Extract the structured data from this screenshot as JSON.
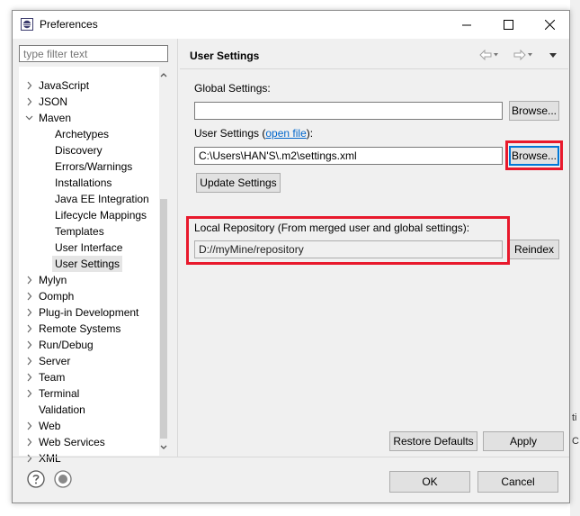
{
  "window": {
    "title": "Preferences"
  },
  "filter": {
    "placeholder": "type filter text"
  },
  "tree": {
    "items": [
      {
        "label": "JavaScript",
        "expander": "collapsed"
      },
      {
        "label": "JSON",
        "expander": "collapsed"
      },
      {
        "label": "Maven",
        "expander": "expanded"
      },
      {
        "label": "Archetypes",
        "expander": "none"
      },
      {
        "label": "Discovery",
        "expander": "none"
      },
      {
        "label": "Errors/Warnings",
        "expander": "none"
      },
      {
        "label": "Installations",
        "expander": "none"
      },
      {
        "label": "Java EE Integration",
        "expander": "none"
      },
      {
        "label": "Lifecycle Mappings",
        "expander": "none"
      },
      {
        "label": "Templates",
        "expander": "none"
      },
      {
        "label": "User Interface",
        "expander": "none"
      },
      {
        "label": "User Settings",
        "expander": "none",
        "selected": true
      },
      {
        "label": "Mylyn",
        "expander": "collapsed"
      },
      {
        "label": "Oomph",
        "expander": "collapsed"
      },
      {
        "label": "Plug-in Development",
        "expander": "collapsed"
      },
      {
        "label": "Remote Systems",
        "expander": "collapsed"
      },
      {
        "label": "Run/Debug",
        "expander": "collapsed"
      },
      {
        "label": "Server",
        "expander": "collapsed"
      },
      {
        "label": "Team",
        "expander": "collapsed"
      },
      {
        "label": "Terminal",
        "expander": "collapsed"
      },
      {
        "label": "Validation",
        "expander": "none"
      },
      {
        "label": "Web",
        "expander": "collapsed"
      },
      {
        "label": "Web Services",
        "expander": "collapsed"
      },
      {
        "label": "XML",
        "expander": "collapsed"
      }
    ]
  },
  "page": {
    "title": "User Settings",
    "global_settings_label": "Global Settings:",
    "global_settings_value": "",
    "browse_label": "Browse...",
    "user_settings_label": "User Settings",
    "open_file_link": "open file",
    "user_settings_value": "C:\\Users\\HAN'S\\.m2\\settings.xml",
    "update_settings_label": "Update Settings",
    "local_repo_label": "Local Repository (From merged user and global settings):",
    "local_repo_value": "D://myMine/repository",
    "reindex_label": "Reindex",
    "restore_defaults_label": "Restore Defaults",
    "apply_label": "Apply"
  },
  "footer": {
    "ok_label": "OK",
    "cancel_label": "Cancel"
  },
  "colors": {
    "highlight": "#e8192c",
    "link": "#0066cc",
    "focus": "#0078d7"
  }
}
